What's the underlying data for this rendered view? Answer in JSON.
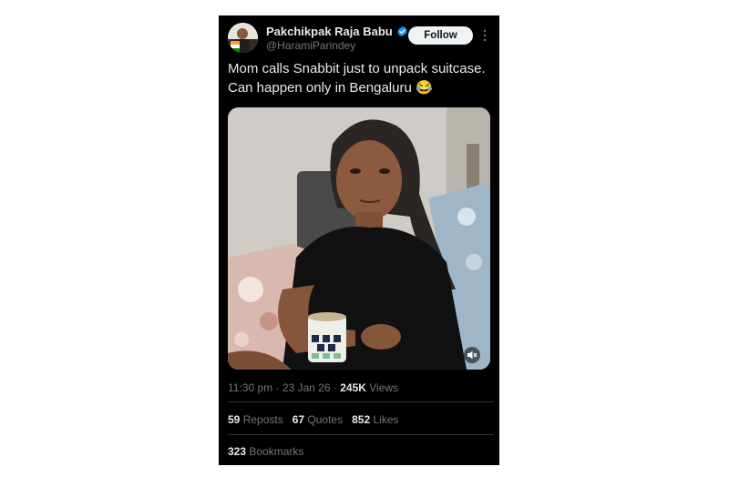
{
  "author": {
    "display_name": "Pakchikpak Raja Babu",
    "handle": "@HaramiParindey",
    "verified": true
  },
  "follow_label": "Follow",
  "tweet": {
    "line1": "Mom calls Snabbit just to unpack suitcase.",
    "line2": "Can happen only in Bengaluru",
    "emoji": "😂"
  },
  "meta": {
    "time": "11:30 pm",
    "sep1": " · ",
    "date": "23 Jan 26",
    "sep2": " · ",
    "views_count": "245K",
    "views_label": " Views"
  },
  "stats": {
    "reposts_count": "59",
    "reposts_label": " Reposts",
    "quotes_count": "67",
    "quotes_label": " Quotes",
    "likes_count": "852",
    "likes_label": " Likes",
    "bookmarks_count": "323",
    "bookmarks_label": " Bookmarks"
  },
  "media": {
    "type": "video",
    "mute_icon": "speaker-muted-icon"
  },
  "colors": {
    "card_bg": "#000000",
    "text_primary": "#e7e9ea",
    "text_secondary": "#71767b",
    "verified_blue": "#1d9bf0",
    "follow_bg": "#eff3f4"
  }
}
